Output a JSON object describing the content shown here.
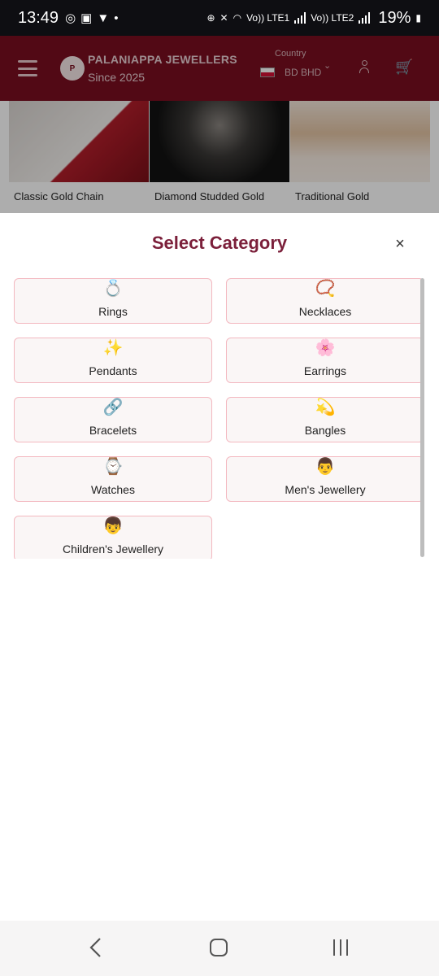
{
  "status_bar": {
    "time": "13:49",
    "battery": "19%",
    "network_labels": [
      "Vo)) LTE1",
      "Vo)) LTE2"
    ]
  },
  "header": {
    "logo_text": "P",
    "brand_name": "PALANIAPPA JEWELLERS",
    "tagline": "Since 2025",
    "country_label": "Country",
    "country_value": "BD BHD"
  },
  "products": [
    {
      "title": "Classic Gold Chain"
    },
    {
      "title": "Diamond Studded Gold"
    },
    {
      "title": "Traditional Gold"
    }
  ],
  "sheet": {
    "title": "Select Category",
    "close_icon": "×",
    "categories": [
      {
        "label": "Rings",
        "icon": "💍",
        "icon_name": "ring-icon"
      },
      {
        "label": "Necklaces",
        "icon": "📿",
        "icon_name": "necklace-icon"
      },
      {
        "label": "Pendants",
        "icon": "✨",
        "icon_name": "sparkles-icon"
      },
      {
        "label": "Earrings",
        "icon": "🌸",
        "icon_name": "flower-icon"
      },
      {
        "label": "Bracelets",
        "icon": "🔗",
        "icon_name": "link-icon"
      },
      {
        "label": "Bangles",
        "icon": "💫",
        "icon_name": "dizzy-icon"
      },
      {
        "label": "Watches",
        "icon": "⌚",
        "icon_name": "watch-icon"
      },
      {
        "label": "Men's Jewellery",
        "icon": "👨",
        "icon_name": "man-icon"
      },
      {
        "label": "Children's Jewellery",
        "icon": "👦",
        "icon_name": "boy-icon"
      }
    ]
  },
  "colors": {
    "header_bg": "#7a0e1f",
    "title_color": "#7b1f3a",
    "card_border": "#f3b8c0",
    "card_bg": "#faf6f6"
  }
}
